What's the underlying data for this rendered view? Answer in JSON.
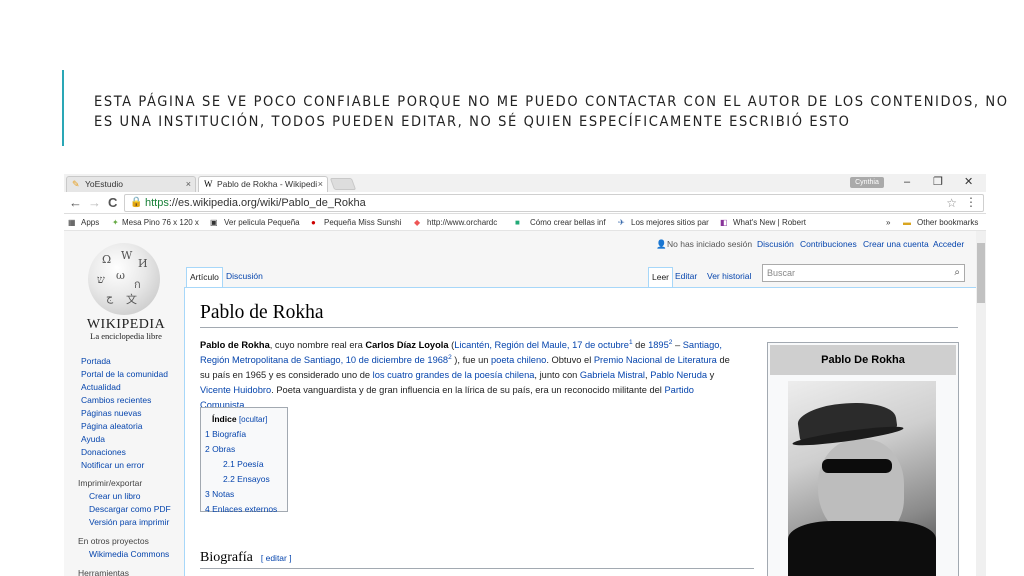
{
  "slide": {
    "line1": "Esta página se ve poco confiable porque no me puedo contactar con el autor de los contenidos, no",
    "line2": "es una institución, todos pueden editar, no sé quien específicamente escribió esto"
  },
  "browser": {
    "tabs": [
      {
        "label": "YoEstudio",
        "close": "×"
      },
      {
        "label": "Pablo de Rokha - Wikipedi",
        "close": "×"
      }
    ],
    "profile": "Cynthia",
    "window": {
      "min": "–",
      "max": "❐",
      "close": "✕"
    },
    "nav": {
      "back": "←",
      "forward": "→",
      "reload": "C"
    },
    "url_scheme": "https",
    "url_rest": "://es.wikipedia.org/wiki/Pablo_de_Rokha",
    "bookmarks": [
      "Apps",
      "Mesa Pino 76 x 120 x",
      "Ver pelicula Pequeña",
      "Pequeña Miss Sunshi",
      "http://www.orchardc",
      "Cómo crear bellas inf",
      "Los mejores sitios par",
      "What's New | Robert",
      "»",
      "Other bookmarks"
    ]
  },
  "wiki": {
    "personal": {
      "notlogged": "No has iniciado sesión",
      "talk": "Discusión",
      "contribs": "Contribuciones",
      "create": "Crear una cuenta",
      "login": "Acceder"
    },
    "logo_text": "Wikipedia",
    "tagline": "La enciclopedia libre",
    "sidebar": {
      "main": [
        "Portada",
        "Portal de la comunidad",
        "Actualidad",
        "Cambios recientes",
        "Páginas nuevas",
        "Página aleatoria",
        "Ayuda",
        "Donaciones",
        "Notificar un error"
      ],
      "print_header": "Imprimir/exportar",
      "print": [
        "Crear un libro",
        "Descargar como PDF",
        "Versión para imprimir"
      ],
      "other_header": "En otros proyectos",
      "other": [
        "Wikimedia Commons"
      ],
      "tools_header": "Herramientas"
    },
    "tabs": {
      "article": "Artículo",
      "discussion": "Discusión",
      "read": "Leer",
      "edit": "Editar",
      "history": "Ver historial"
    },
    "search_placeholder": "Buscar",
    "title": "Pablo de Rokha",
    "para": {
      "l1": {
        "a": "Pablo de Rokha",
        "b": ", cuyo nombre real era ",
        "c": "Carlos Díaz Loyola",
        "d": " (",
        "e": "Licantén, Región del Maule, 17 de octubre",
        "f": "1",
        "g": " de ",
        "h": "1895",
        "i": "2",
        "j": " – ",
        "k": "Santiago,"
      },
      "l2": {
        "a": "Región Metropolitana de Santiago, 10 de diciembre de 1968",
        "b": "2",
        "c": " ), fue un ",
        "d": "poeta chileno",
        "e": ". Obtuvo el ",
        "f": "Premio Nacional de Literatura",
        "g": " de"
      },
      "l3": {
        "a": "su país en 1965 y es considerado uno de ",
        "b": "los cuatro grandes de la poesía chilena",
        "c": ", junto con ",
        "d": "Gabriela Mistral",
        "e": ", ",
        "f": "Pablo Neruda",
        "g": " y"
      },
      "l4": {
        "a": "Vicente Huidobro",
        "b": ". Poeta vanguardista y de gran influencia en la lírica de su país, era un reconocido militante del ",
        "c": "Partido"
      },
      "l5": {
        "a": "Comunista",
        "b": "."
      }
    },
    "toc": {
      "title": "Índice",
      "toggle": "[ocultar]",
      "items": [
        "1 Biografía",
        "2 Obras",
        "2.1 Poesía",
        "2.2 Ensayos",
        "3 Notas",
        "4 Enlaces externos"
      ]
    },
    "section": {
      "title": "Biografía",
      "edit": "[ editar ]"
    },
    "infobox_title": "Pablo De Rokha"
  }
}
